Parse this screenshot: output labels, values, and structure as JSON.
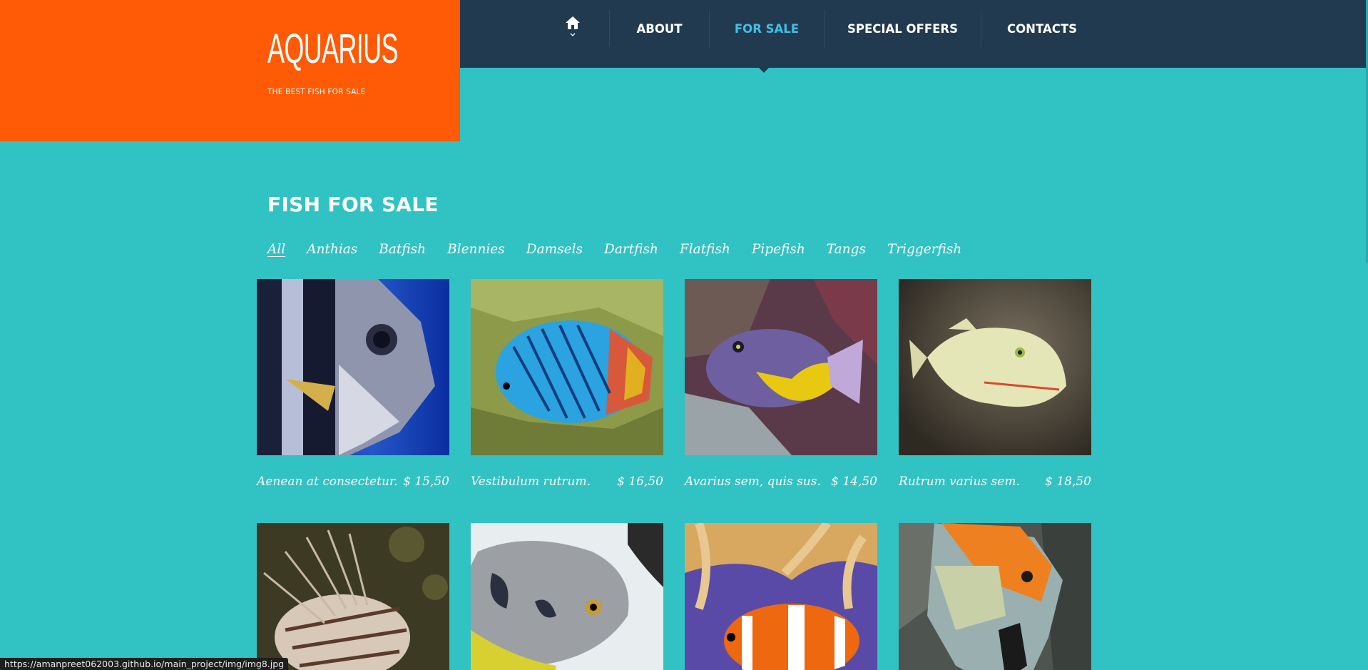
{
  "header": {
    "logo_title": "AQUARIUS",
    "logo_subtitle": "THE BEST FISH FOR SALE"
  },
  "nav": {
    "home_icon": "home-icon",
    "items": [
      {
        "label": "ABOUT",
        "active": false
      },
      {
        "label": "FOR SALE",
        "active": true
      },
      {
        "label": "SPECIAL OFFERS",
        "active": false
      },
      {
        "label": "CONTACTS",
        "active": false
      }
    ]
  },
  "section": {
    "title": "FISH FOR SALE",
    "filters": [
      "All",
      "Anthias",
      "Batfish",
      "Blennies",
      "Damsels",
      "Dartfish",
      "Flatfish",
      "Pipefish",
      "Tangs",
      "Triggerfish"
    ],
    "active_filter": "All"
  },
  "products": [
    {
      "name": "Aenean at consectetur.",
      "price": "$ 15,50"
    },
    {
      "name": "Vestibulum rutrum.",
      "price": "$ 16,50"
    },
    {
      "name": "Avarius sem, quis sus.",
      "price": "$ 14,50"
    },
    {
      "name": "Rutrum varius sem.",
      "price": "$ 18,50"
    },
    {
      "name": "",
      "price": ""
    },
    {
      "name": "",
      "price": ""
    },
    {
      "name": "",
      "price": ""
    },
    {
      "name": "",
      "price": ""
    }
  ],
  "status_bar": {
    "url": "https://amanpreet062003.github.io/main_project/img/img8.jpg"
  },
  "colors": {
    "background": "#31c2c3",
    "logo_block": "#ff5a05",
    "navbar": "#223a50",
    "nav_active": "#3fc0e8"
  }
}
